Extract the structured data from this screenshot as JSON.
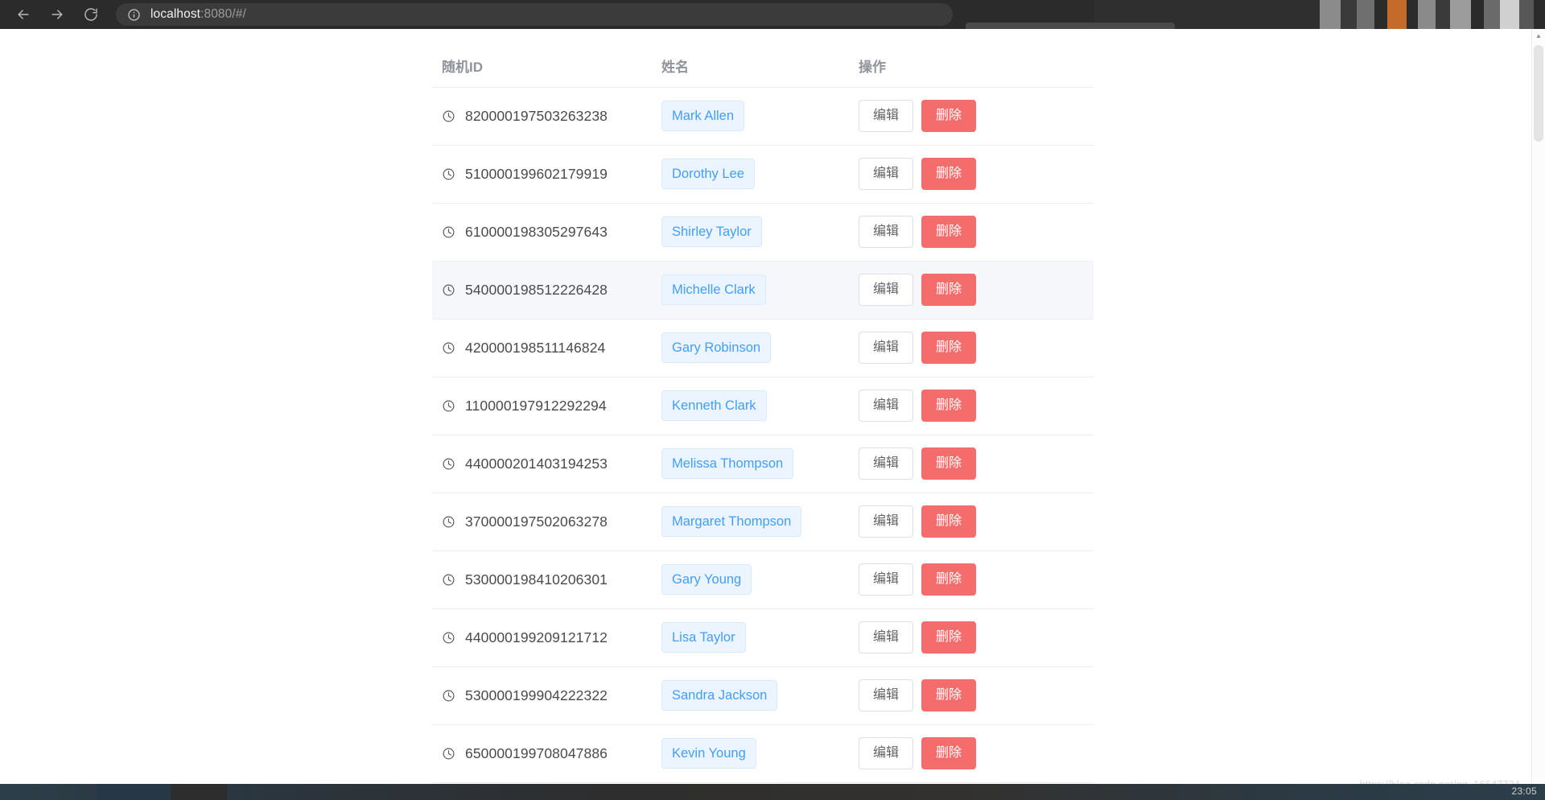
{
  "browser": {
    "back_label": "←",
    "forward_label": "→",
    "reload_label": "⟳",
    "info_icon": "info-circle-icon",
    "url_host": "localhost",
    "url_path": ":8080/#/"
  },
  "table": {
    "columns": {
      "id": "随机ID",
      "name": "姓名",
      "ops": "操作"
    },
    "edit_label": "编辑",
    "delete_label": "删除",
    "row_icon": "clock-icon",
    "colors": {
      "tag_text": "#409eff",
      "tag_bg": "#ecf5ff",
      "delete_bg": "#f56c6c",
      "header_text": "#909399",
      "row_hover_bg": "#f5f7fa"
    },
    "rows": [
      {
        "id": "820000197503263238",
        "name": "Mark Allen",
        "hover": false
      },
      {
        "id": "510000199602179919",
        "name": "Dorothy Lee",
        "hover": false
      },
      {
        "id": "610000198305297643",
        "name": "Shirley Taylor",
        "hover": false
      },
      {
        "id": "540000198512226428",
        "name": "Michelle Clark",
        "hover": true
      },
      {
        "id": "420000198511146824",
        "name": "Gary Robinson",
        "hover": false
      },
      {
        "id": "110000197912292294",
        "name": "Kenneth Clark",
        "hover": false
      },
      {
        "id": "440000201403194253",
        "name": "Melissa Thompson",
        "hover": false
      },
      {
        "id": "370000197502063278",
        "name": "Margaret Thompson",
        "hover": false
      },
      {
        "id": "530000198410206301",
        "name": "Gary Young",
        "hover": false
      },
      {
        "id": "440000199209121712",
        "name": "Lisa Taylor",
        "hover": false
      },
      {
        "id": "530000199904222322",
        "name": "Sandra Jackson",
        "hover": false
      },
      {
        "id": "650000199708047886",
        "name": "Kevin Young",
        "hover": false
      }
    ]
  },
  "watermark": {
    "text": "https://blog.csdn.net/qq_16647724"
  },
  "taskbar": {
    "clock": "23:05"
  }
}
